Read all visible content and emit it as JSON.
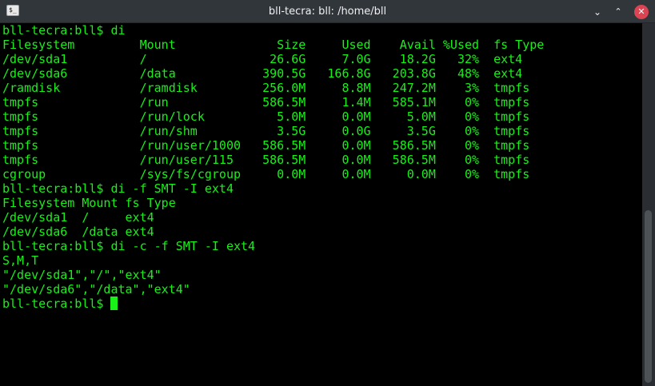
{
  "window": {
    "title": "bll-tecra: bll: /home/bll",
    "app_icon_label": "$_",
    "minimize_icon": "minimize-icon",
    "maximize_icon": "maximize-icon",
    "close_icon": "close-icon",
    "close_color": "#da4453"
  },
  "terminal": {
    "text_color": "#18f018",
    "background": "#000000",
    "lines": [
      "bll-tecra:bll$ di",
      "Filesystem         Mount              Size     Used    Avail %Used  fs Type",
      "/dev/sda1          /                 26.6G     7.0G    18.2G   32%  ext4",
      "/dev/sda6          /data            390.5G   166.8G   203.8G   48%  ext4",
      "/ramdisk           /ramdisk         256.0M     8.8M   247.2M    3%  tmpfs",
      "tmpfs              /run             586.5M     1.4M   585.1M    0%  tmpfs",
      "tmpfs              /run/lock          5.0M     0.0M     5.0M    0%  tmpfs",
      "tmpfs              /run/shm           3.5G     0.0G     3.5G    0%  tmpfs",
      "tmpfs              /run/user/1000   586.5M     0.0M   586.5M    0%  tmpfs",
      "tmpfs              /run/user/115    586.5M     0.0M   586.5M    0%  tmpfs",
      "cgroup             /sys/fs/cgroup     0.0M     0.0M     0.0M    0%  tmpfs",
      "bll-tecra:bll$ di -f SMT -I ext4",
      "Filesystem Mount fs Type",
      "/dev/sda1  /     ext4",
      "/dev/sda6  /data ext4",
      "bll-tecra:bll$ di -c -f SMT -I ext4",
      "S,M,T",
      "\"/dev/sda1\",\"/\",\"ext4\"",
      "\"/dev/sda6\",\"/data\",\"ext4\"",
      "bll-tecra:bll$ "
    ]
  },
  "scrollbar": {
    "scroll_position": 1.0
  }
}
